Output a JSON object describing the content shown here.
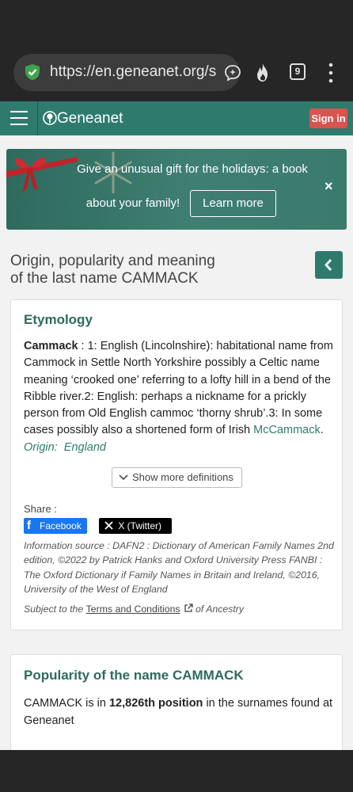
{
  "browser": {
    "url": "https://en.geneanet.org/s",
    "tab_count": "9"
  },
  "header": {
    "logo_text": "Geneanet",
    "signin_label": "Sign in"
  },
  "banner": {
    "message_line1": "Give an unusual gift for the holidays: a book",
    "message_line2": "about your family!",
    "button_label": "Learn more",
    "close_label": "×"
  },
  "page": {
    "title_line1": "Origin, popularity and meaning",
    "title_line2": "of the last name CAMMACK"
  },
  "etymology": {
    "title": "Etymology",
    "name": "Cammack",
    "text": " : 1: English (Lincolnshire): habitational name from Cammock in Settle North Yorkshire possibly a Celtic name meaning ‘crooked one’ referring to a lofty hill in a bend of the Ribble river.2: English: perhaps a nickname for a prickly person from Old English cammoc ‘thorny shrub’.3: In some cases possibly also a shortened form of Irish ",
    "link_text": "McCammack",
    "after_link": ".",
    "origin_label": "Origin:",
    "origin_value": "England",
    "more_label": "Show more definitions",
    "share_label": "Share :",
    "facebook_label": "Facebook",
    "twitter_label": "X (Twitter)",
    "source_text": "Information source : DAFN2 : Dictionary of American Family Names 2nd edition, ©2022 by Patrick Hanks and Oxford University Press FANBI : The Oxford Dictionary if Family Names in Britain and Ireland, ©2016, University of the West of England",
    "terms_prefix": "Subject to the ",
    "terms_link": "Terms and Conditions",
    "terms_suffix": " of Ancestry"
  },
  "popularity": {
    "title": "Popularity of the name CAMMACK",
    "text_prefix": "CAMMACK is in ",
    "rank": "12,826th position",
    "text_suffix": " in the surnames found at Geneanet"
  },
  "colors": {
    "brand_green": "#2e7b6e",
    "signin_red": "#d9534f",
    "facebook_blue": "#1877f2"
  }
}
